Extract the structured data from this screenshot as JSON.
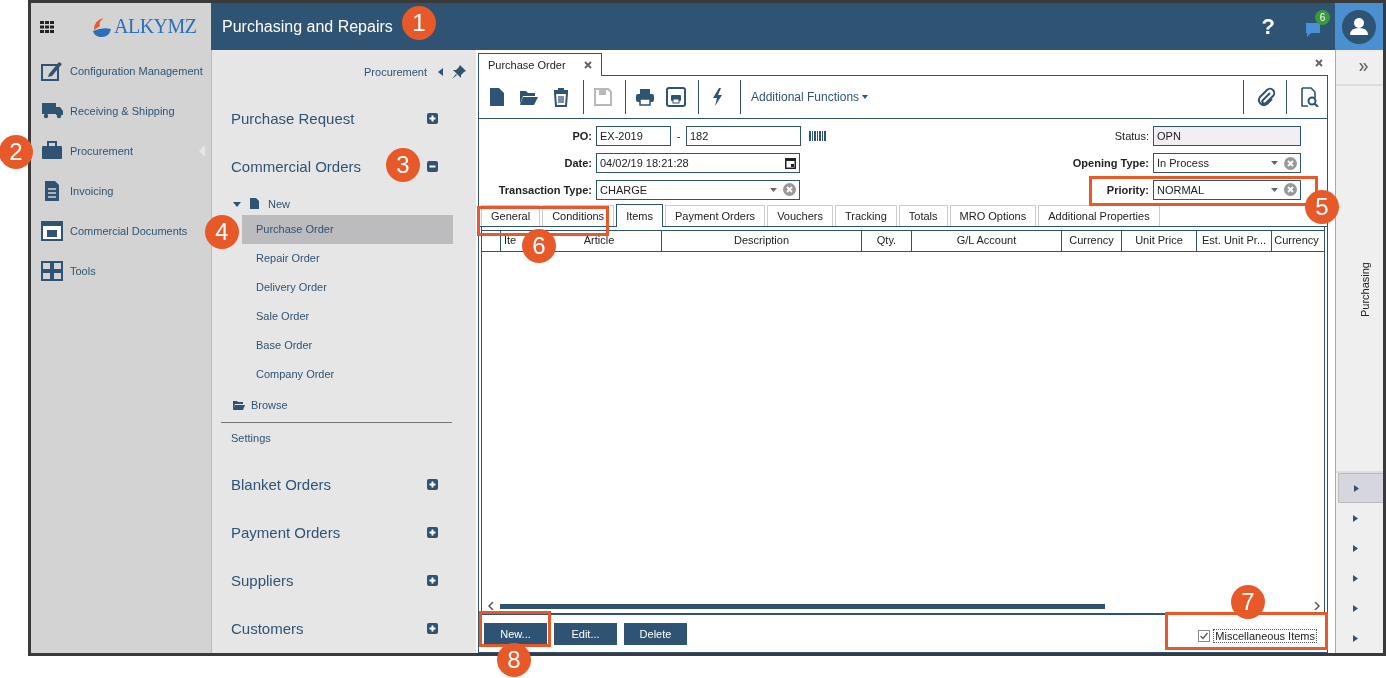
{
  "header": {
    "logo": "ALKYMZ",
    "title": "Purchasing and Repairs",
    "help": "?",
    "notifications": "6"
  },
  "nav": {
    "items": [
      {
        "label": "Configuration Management",
        "selected": false
      },
      {
        "label": "Receiving & Shipping",
        "selected": false
      },
      {
        "label": "Procurement",
        "selected": true
      },
      {
        "label": "Invoicing",
        "selected": false
      },
      {
        "label": "Commercial Documents",
        "selected": false
      },
      {
        "label": "Tools",
        "selected": false
      }
    ]
  },
  "menu": {
    "title": "Procurement",
    "sections": [
      {
        "kind": "group",
        "label": "Purchase Request",
        "expanded": false
      },
      {
        "kind": "group",
        "label": "Commercial Orders",
        "expanded": true,
        "children": [
          {
            "kind": "document",
            "label": "New",
            "expanded": true,
            "children": [
              {
                "label": "Purchase Order",
                "selected": true
              },
              {
                "label": "Repair Order",
                "selected": false
              },
              {
                "label": "Delivery Order",
                "selected": false
              },
              {
                "label": "Sale Order",
                "selected": false
              },
              {
                "label": "Base Order",
                "selected": false
              },
              {
                "label": "Company Order",
                "selected": false
              }
            ]
          },
          {
            "kind": "folder",
            "label": "Browse"
          }
        ]
      },
      {
        "kind": "link",
        "label": "Settings"
      },
      {
        "kind": "group",
        "label": "Blanket Orders",
        "expanded": false
      },
      {
        "kind": "group",
        "label": "Payment Orders",
        "expanded": false
      },
      {
        "kind": "group",
        "label": "Suppliers",
        "expanded": false
      },
      {
        "kind": "group",
        "label": "Customers",
        "expanded": false
      }
    ]
  },
  "document_tab": {
    "label": "Purchase Order",
    "selected": true
  },
  "toolbar": {
    "groups": [
      [
        {
          "kind": "new",
          "disabled": false
        },
        {
          "kind": "open",
          "disabled": false
        },
        {
          "kind": "delete",
          "disabled": false
        }
      ],
      [
        {
          "kind": "save",
          "disabled": true
        }
      ],
      [
        {
          "kind": "print",
          "disabled": false
        },
        {
          "kind": "preview",
          "disabled": false
        }
      ],
      [
        {
          "kind": "action",
          "disabled": false
        }
      ]
    ],
    "menu": "Additional Functions",
    "right": [
      {
        "kind": "attach",
        "disabled": false
      },
      {
        "kind": "inspect",
        "disabled": false
      }
    ]
  },
  "form": {
    "left": [
      {
        "kind": "split",
        "label": "PO:",
        "required": true,
        "values": [
          "EX-2019",
          "182"
        ],
        "separator": "-"
      },
      {
        "kind": "date",
        "label": "Date:",
        "required": true,
        "value": "04/02/19 18:21:28"
      },
      {
        "kind": "select",
        "label": "Transaction Type:",
        "required": true,
        "value": "CHARGE"
      }
    ],
    "right": [
      {
        "kind": "readonly",
        "label": "Status:",
        "required": false,
        "value": "OPN"
      },
      {
        "kind": "select",
        "label": "Opening Type:",
        "required": true,
        "value": "In Process"
      },
      {
        "kind": "select",
        "label": "Priority:",
        "required": true,
        "value": "NORMAL"
      }
    ]
  },
  "tabs": [
    {
      "label": "General",
      "selected": false
    },
    {
      "label": "Conditions",
      "selected": false
    },
    {
      "label": "Items",
      "selected": true
    },
    {
      "label": "Payment Orders",
      "selected": false
    },
    {
      "label": "Vouchers",
      "selected": false
    },
    {
      "label": "Tracking",
      "selected": false
    },
    {
      "label": "Totals",
      "selected": false
    },
    {
      "label": "MRO Options",
      "selected": false
    },
    {
      "label": "Additional Properties",
      "selected": false
    }
  ],
  "table": {
    "columns": [
      "Ite",
      "Article",
      "Description",
      "Qty.",
      "G/L Account",
      "Currency",
      "Unit Price",
      "Est. Unit Pr...",
      "Currency"
    ]
  },
  "buttons": [
    "New...",
    "Edit...",
    "Delete"
  ],
  "misc_checkbox": {
    "label": "Miscellaneous Items",
    "checked": true
  },
  "side_panel": {
    "title": "Purchasing",
    "expanders": [
      {
        "selected": true
      },
      {
        "selected": false
      },
      {
        "selected": false
      },
      {
        "selected": false
      },
      {
        "selected": false
      },
      {
        "selected": false
      }
    ]
  },
  "callouts": [
    {
      "number": "1"
    },
    {
      "number": "2"
    },
    {
      "number": "3"
    },
    {
      "number": "4"
    },
    {
      "number": "5"
    },
    {
      "number": "6"
    },
    {
      "number": "7"
    },
    {
      "number": "8"
    }
  ]
}
